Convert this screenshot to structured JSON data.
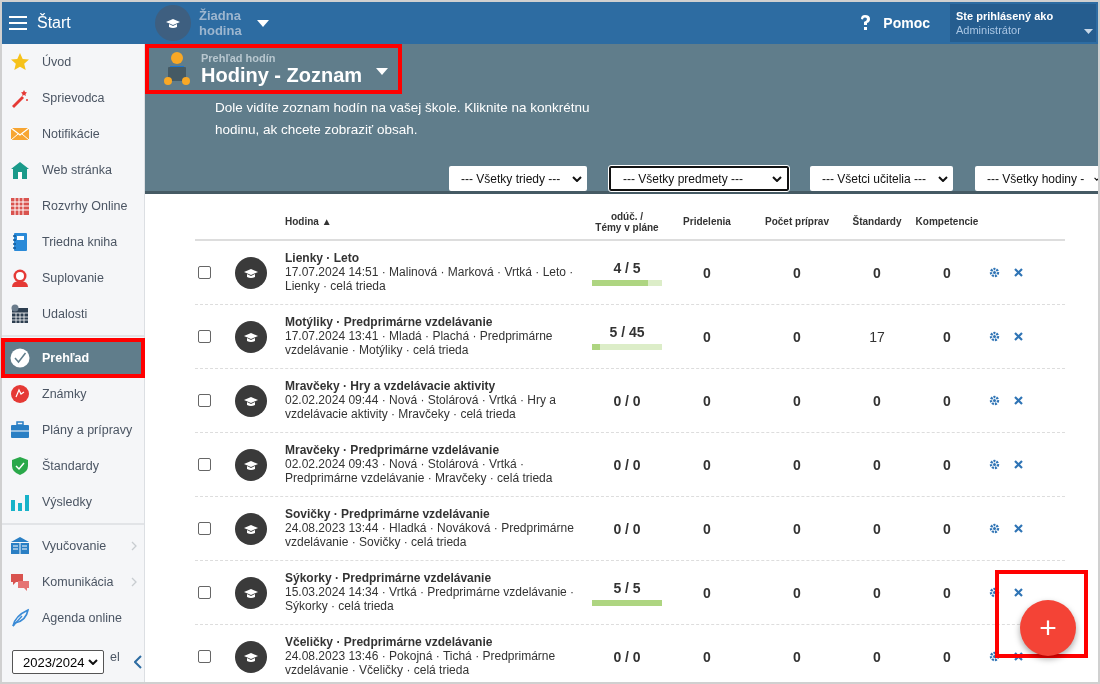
{
  "topbar": {
    "menu_label": "Štart",
    "lesson": "Žiadna hodina",
    "help": "Pomoc",
    "user": {
      "caption": "Ste prihlásený ako",
      "name": "Administrátor"
    }
  },
  "sidebar": {
    "groups": [
      [
        {
          "label": "Úvod",
          "selected": false,
          "highlighted": false,
          "has_submenu": false
        },
        {
          "label": "Sprievodca",
          "selected": false,
          "highlighted": false,
          "has_submenu": false
        },
        {
          "label": "Notifikácie",
          "selected": false,
          "highlighted": false,
          "has_submenu": false
        },
        {
          "label": "Web stránka",
          "selected": false,
          "highlighted": false,
          "has_submenu": false
        },
        {
          "label": "Rozvrhy Online",
          "selected": false,
          "highlighted": false,
          "has_submenu": false
        },
        {
          "label": "Triedna kniha",
          "selected": false,
          "highlighted": false,
          "has_submenu": false
        },
        {
          "label": "Suplovanie",
          "selected": false,
          "highlighted": false,
          "has_submenu": false
        },
        {
          "label": "Udalosti",
          "selected": false,
          "highlighted": false,
          "has_submenu": false
        }
      ],
      [
        {
          "label": "Prehľad",
          "selected": true,
          "highlighted": true,
          "has_submenu": false
        },
        {
          "label": "Známky",
          "selected": false,
          "highlighted": false,
          "has_submenu": false
        },
        {
          "label": "Plány a prípravy",
          "selected": false,
          "highlighted": false,
          "has_submenu": false
        },
        {
          "label": "Štandardy",
          "selected": false,
          "highlighted": false,
          "has_submenu": false
        },
        {
          "label": "Výsledky",
          "selected": false,
          "highlighted": false,
          "has_submenu": false
        }
      ],
      [
        {
          "label": "Vyučovanie",
          "selected": false,
          "highlighted": false,
          "has_submenu": true
        },
        {
          "label": "Komunikácia",
          "selected": false,
          "highlighted": false,
          "has_submenu": true
        },
        {
          "label": "Agenda online",
          "selected": false,
          "highlighted": false,
          "has_submenu": false
        }
      ]
    ],
    "covered_item_text": "el",
    "year": "2023/2024"
  },
  "header": {
    "subtitle": "Prehľad hodín",
    "title": "Hodiny - Zoznam",
    "highlighted": true,
    "description": "Dole vidíte zoznam hodín na vašej škole. Kliknite na konkrétnu hodinu, ak chcete zobraziť obsah.",
    "filters": [
      {
        "label": "--- Všetky triedy ---",
        "focused": false
      },
      {
        "label": "--- Všetky predmety ---",
        "focused": true
      },
      {
        "label": "--- Všetci učitelia ---",
        "focused": false
      },
      {
        "label": "--- Všetky hodiny -",
        "focused": false
      }
    ]
  },
  "table": {
    "columns": [
      "Hodina ▲",
      "odúč. /\nTémy v pláne",
      "Pridelenia",
      "Počet príprav",
      "Štandardy",
      "Kompetencie"
    ],
    "rows": [
      {
        "checked": false,
        "title": "Lienky · Leto",
        "details": "17.07.2024 14:51 · Malinová · Marková · Vrtká · Leto · Lienky · celá trieda",
        "taught": "4 / 5",
        "level": 0.8,
        "assignments": "0",
        "preparations": "0",
        "standards": "0",
        "competences": "0"
      },
      {
        "checked": false,
        "title": "Motýliky · Predprimárne vzdelávanie",
        "details": "17.07.2024 13:41 · Mladá · Plachá · Predprimárne vzdelávanie · Motýliky · celá trieda",
        "taught": "5 / 45",
        "level": 0.11,
        "assignments": "0",
        "preparations": "0",
        "standards": "17",
        "competences": "0"
      },
      {
        "checked": false,
        "title": "Mravčeky · Hry a vzdelávacie aktivity",
        "details": "02.02.2024 09:44 · Nová · Stolárová · Vrtká · Hry a vzdelávacie aktivity · Mravčeky · celá trieda",
        "taught": "0 / 0",
        "assignments": "0",
        "preparations": "0",
        "standards": "0",
        "competences": "0"
      },
      {
        "checked": false,
        "title": "Mravčeky · Predprimárne vzdelávanie",
        "details": "02.02.2024 09:43 · Nová · Stolárová · Vrtká · Predprimárne vzdelávanie · Mravčeky · celá trieda",
        "taught": "0 / 0",
        "assignments": "0",
        "preparations": "0",
        "standards": "0",
        "competences": "0"
      },
      {
        "checked": false,
        "title": "Sovičky · Predprimárne vzdelávanie",
        "details": "24.08.2023 13:44 · Hladká · Nováková · Predprimárne vzdelávanie · Sovičky · celá trieda",
        "taught": "0 / 0",
        "assignments": "0",
        "preparations": "0",
        "standards": "0",
        "competences": "0"
      },
      {
        "checked": false,
        "title": "Sýkorky · Predprimárne vzdelávanie",
        "details": "15.03.2024 14:34 · Vrtká · Predprimárne vzdelávanie · Sýkorky · celá trieda",
        "taught": "5 / 5",
        "level": 1,
        "assignments": "0",
        "preparations": "0",
        "standards": "0",
        "competences": "0"
      },
      {
        "checked": false,
        "title": "Včeličky · Predprimárne vzdelávanie",
        "details": "24.08.2023 13:46 · Pokojná · Tichá · Predprimárne vzdelávanie · Včeličky · celá trieda",
        "taught": "0 / 0",
        "assignments": "0",
        "preparations": "0",
        "standards": "0",
        "competences": "0"
      }
    ]
  },
  "fab": {
    "label": "+",
    "highlighted": true
  }
}
